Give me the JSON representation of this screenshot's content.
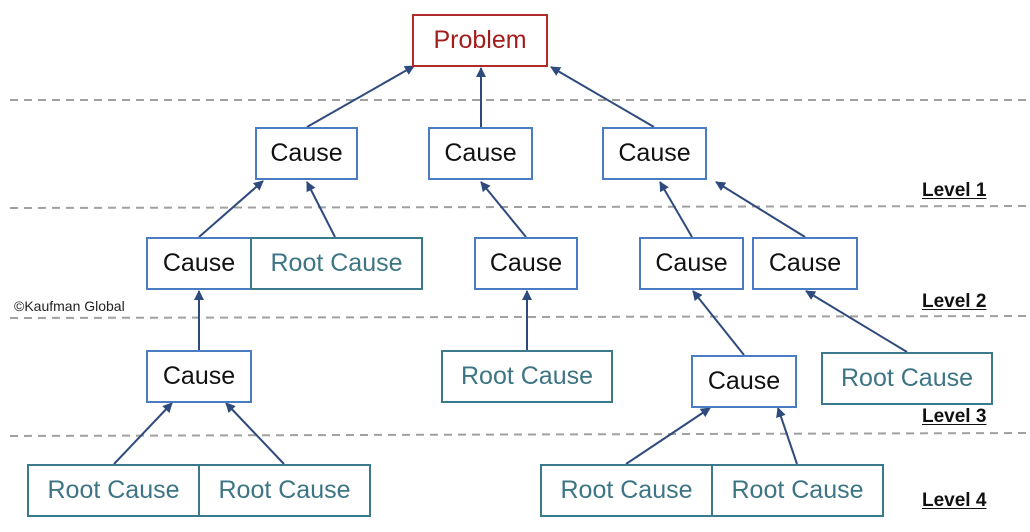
{
  "diagram": {
    "title_node": "Problem",
    "copyright": "©Kaufman Global",
    "levels": [
      "Level 1",
      "Level 2",
      "Level 3",
      "Level 4"
    ],
    "colors": {
      "problem": "#b22b2b",
      "cause_border": "#4a7cc4",
      "root_cause": "#3d7585",
      "arrow": "#2f4a7d",
      "divider": "#a0a0a0"
    },
    "nodes": [
      {
        "id": "problem",
        "label": "Problem",
        "type": "problem"
      },
      {
        "id": "c1",
        "label": "Cause",
        "type": "cause",
        "level": 1
      },
      {
        "id": "c2",
        "label": "Cause",
        "type": "cause",
        "level": 1
      },
      {
        "id": "c3",
        "label": "Cause",
        "type": "cause",
        "level": 1
      },
      {
        "id": "c4",
        "label": "Cause",
        "type": "cause",
        "level": 2
      },
      {
        "id": "r1",
        "label": "Root Cause",
        "type": "root",
        "level": 2
      },
      {
        "id": "c5",
        "label": "Cause",
        "type": "cause",
        "level": 2
      },
      {
        "id": "c6",
        "label": "Cause",
        "type": "cause",
        "level": 2
      },
      {
        "id": "c7",
        "label": "Cause",
        "type": "cause",
        "level": 2
      },
      {
        "id": "c8",
        "label": "Cause",
        "type": "cause",
        "level": 3
      },
      {
        "id": "r2",
        "label": "Root Cause",
        "type": "root",
        "level": 3
      },
      {
        "id": "c9",
        "label": "Cause",
        "type": "cause",
        "level": 3
      },
      {
        "id": "r3",
        "label": "Root Cause",
        "type": "root",
        "level": 3
      },
      {
        "id": "r4",
        "label": "Root Cause",
        "type": "root",
        "level": 4
      },
      {
        "id": "r5",
        "label": "Root Cause",
        "type": "root",
        "level": 4
      },
      {
        "id": "r6",
        "label": "Root Cause",
        "type": "root",
        "level": 4
      },
      {
        "id": "r7",
        "label": "Root Cause",
        "type": "root",
        "level": 4
      }
    ],
    "edges": [
      {
        "from": "c1",
        "to": "problem"
      },
      {
        "from": "c2",
        "to": "problem"
      },
      {
        "from": "c3",
        "to": "problem"
      },
      {
        "from": "c4",
        "to": "c1"
      },
      {
        "from": "r1",
        "to": "c1"
      },
      {
        "from": "c5",
        "to": "c2"
      },
      {
        "from": "c6",
        "to": "c3"
      },
      {
        "from": "c7",
        "to": "c3"
      },
      {
        "from": "c8",
        "to": "c4"
      },
      {
        "from": "r2",
        "to": "c5"
      },
      {
        "from": "c9",
        "to": "c6"
      },
      {
        "from": "r3",
        "to": "c7"
      },
      {
        "from": "r4",
        "to": "c8"
      },
      {
        "from": "r5",
        "to": "c8"
      },
      {
        "from": "r6",
        "to": "c9"
      },
      {
        "from": "r7",
        "to": "c9"
      }
    ]
  }
}
